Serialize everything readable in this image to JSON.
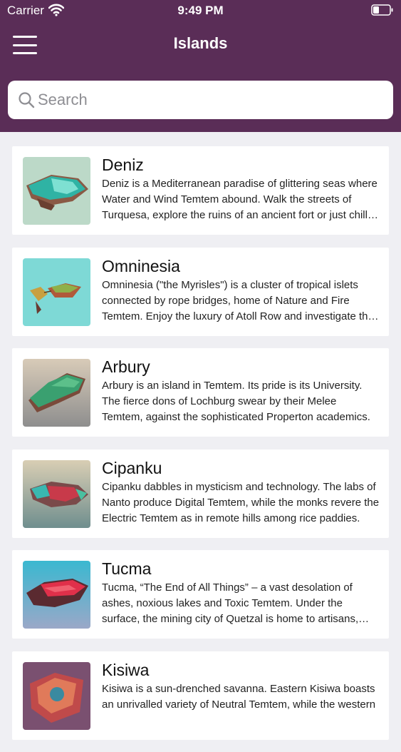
{
  "status_bar": {
    "carrier": "Carrier",
    "time": "9:49 PM",
    "wifi_icon": "wifi-icon",
    "battery_icon": "battery-icon"
  },
  "nav": {
    "title": "Islands",
    "menu_icon": "hamburger-menu-icon"
  },
  "search": {
    "placeholder": "Search",
    "icon": "search-icon"
  },
  "colors": {
    "header": "#5a2d57",
    "background": "#efeff3",
    "card": "#ffffff"
  },
  "islands": [
    {
      "name": "Deniz",
      "description": "Deniz is a Mediterranean paradise of glittering seas where Water and Wind Temtem abound. Walk the streets of Turquesa, explore the ruins of an ancient fort or just chill on the beach and enjoy the sun."
    },
    {
      "name": "Omninesia",
      "description": "Omninesia (\"the Myrisles\") is a cluster of tropical islets connected by rope bridges, home of Nature and Fire Temtem. Enjoy the luxury of Atoll Row and investigate the ancient temples."
    },
    {
      "name": "Arbury",
      "description": "Arbury is an island in Temtem. Its pride is its University. The fierce dons of Lochburg swear by their Melee Temtem, against the sophisticated Properton academics."
    },
    {
      "name": "Cipanku",
      "description": "Cipanku dabbles in mysticism and technology. The labs of Nanto produce Digital Temtem, while the monks revere the Electric Temtem as in remote hills among rice paddies."
    },
    {
      "name": "Tucma",
      "description": "Tucma, “The End of All Things” – a vast desolation of ashes, noxious lakes and Toxic Temtem. Under the surface, the mining city of Quetzal is home to artisans, rebels and miners."
    },
    {
      "name": "Kisiwa",
      "description": "Kisiwa is a sun-drenched savanna. Eastern Kisiwa boasts an unrivalled variety of Neutral Temtem, while the western"
    }
  ]
}
